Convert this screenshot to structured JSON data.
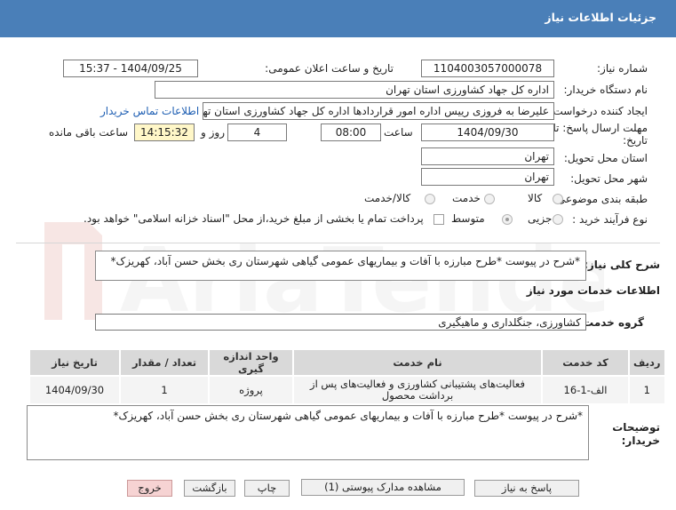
{
  "header": {
    "title": "جزئیات اطلاعات نیاز"
  },
  "fields": {
    "need_number_label": "شماره نیاز:",
    "need_number": "1104003057000078",
    "announce_label": "تاریخ و ساعت اعلان عمومی:",
    "announce_value": "1404/09/25 - 15:37",
    "buyer_org_label": "نام دستگاه خریدار:",
    "buyer_org": "اداره کل جهاد کشاورزی استان تهران",
    "creator_label": "ایجاد کننده درخواست:",
    "creator": "علیرضا به فروزی رییس اداره امور قراردادها اداره کل جهاد کشاورزی استان تهران",
    "contact_link": "اطلاعات تماس خریدار",
    "deadline_label_1": "مهلت ارسال پاسخ: تا",
    "deadline_label_2": "تاریخ:",
    "deadline_date": "1404/09/30",
    "time_label": "ساعت",
    "deadline_time": "08:00",
    "days_value": "4",
    "days_label": "روز و",
    "remaining_time": "14:15:32",
    "remaining_label": "ساعت باقی مانده",
    "province_label": "استان محل تحویل:",
    "province": "تهران",
    "city_label": "شهر محل تحویل:",
    "city": "تهران",
    "category_label": "طبقه بندی موضوعی:",
    "category_options": [
      "کالا",
      "خدمت",
      "کالا/خدمت"
    ],
    "category_selected": "خدمت",
    "process_label": "نوع فرآیند خرید :",
    "process_options": [
      "جزیی",
      "متوسط"
    ],
    "process_selected": "جزیی",
    "payment_text": "پرداخت تمام یا بخشی از مبلغ خرید،از محل \"اسناد خزانه اسلامی\" خواهد بود."
  },
  "summary": {
    "label": "شرح کلی نیاز:",
    "text": "*شرح در پیوست *طرح مبارزه با آفات و بیماریهای عمومی گیاهی شهرستان  ری بخش حسن آباد، کهریزک*"
  },
  "services": {
    "section_title": "اطلاعات خدمات مورد نیاز",
    "group_label": "گروه خدمت:",
    "group_value": "کشاورزی، جنگلداری و ماهیگیری",
    "columns": [
      "ردیف",
      "کد خدمت",
      "نام خدمت",
      "واحد اندازه گیری",
      "تعداد / مقدار",
      "تاریخ نیاز"
    ],
    "rows": [
      {
        "row": "1",
        "code": "الف-1-16",
        "name": "فعالیت‌های پشتیبانی کشاورزی و فعالیت‌های پس از برداشت محصول",
        "unit": "پروژه",
        "qty": "1",
        "date": "1404/09/30"
      }
    ]
  },
  "notes": {
    "label_1": "توضیحات",
    "label_2": "خریدار:",
    "text": "*شرح در پیوست *طرح مبارزه با آفات و بیماریهای عمومی گیاهی شهرستان  ری بخش حسن آباد، کهریزک*"
  },
  "buttons": {
    "reply": "پاسخ به نیاز",
    "docs": "مشاهده مدارک پیوستی (1)",
    "print": "چاپ",
    "back": "بازگشت",
    "exit": "خروج"
  },
  "watermark": {
    "text": "AriaTender.neT"
  },
  "colors": {
    "header": "#4a7fb8",
    "link": "#1f5fb3",
    "highlight": "#fff7c8",
    "exit_button": "#f6d3d3"
  }
}
